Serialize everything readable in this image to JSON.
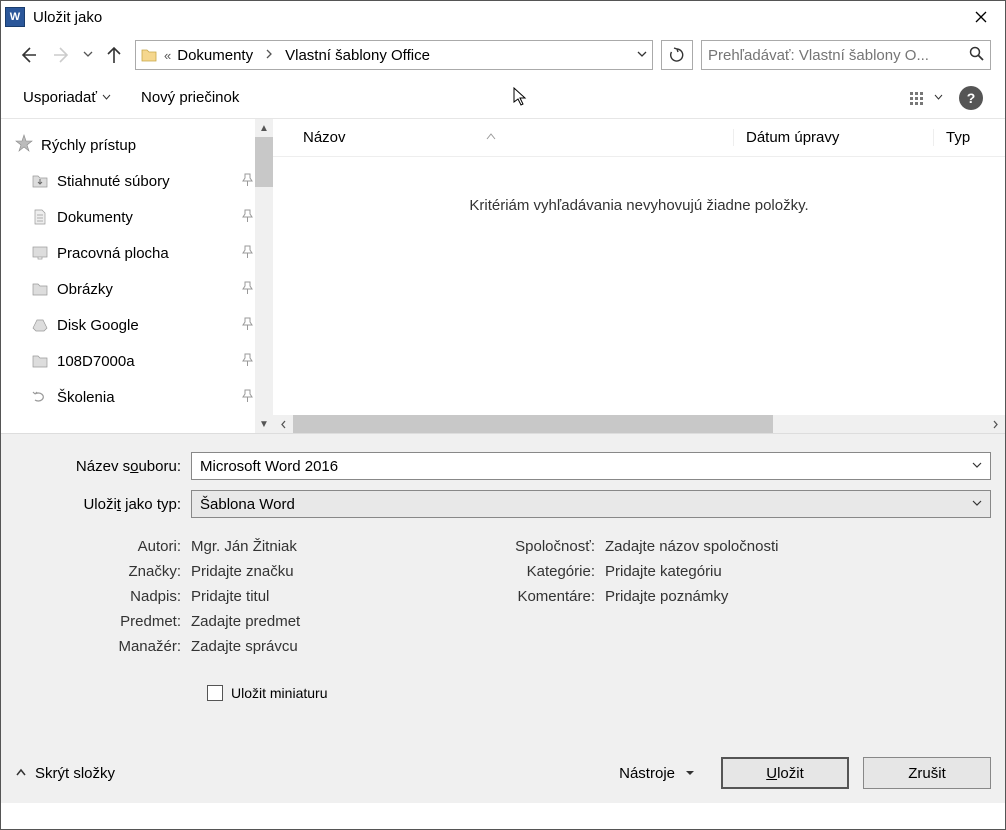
{
  "titlebar": {
    "title": "Uložit jako"
  },
  "nav": {
    "breadcrumb_prefix": "«",
    "breadcrumb": [
      "Dokumenty",
      "Vlastní šablony Office"
    ],
    "search_placeholder": "Prehľadávať: Vlastní šablony O..."
  },
  "toolbar": {
    "organize": "Usporiadať",
    "new_folder": "Nový priečinok"
  },
  "sidebar": {
    "quick_access": "Rýchly prístup",
    "items": [
      "Stiahnuté súbory",
      "Dokumenty",
      "Pracovná plocha",
      "Obrázky",
      "Disk Google",
      "108D7000a",
      "Školenia"
    ]
  },
  "columns": {
    "name": "Názov",
    "date": "Dátum úpravy",
    "type": "Typ"
  },
  "empty_message": "Kritériám vyhľadávania nevyhovujú žiadne položky.",
  "form": {
    "filename_label_pre": "Název s",
    "filename_label_ul": "o",
    "filename_label_post": "uboru:",
    "filename_value": "Microsoft Word 2016",
    "filetype_label_pre": "Uloži",
    "filetype_label_ul": "t",
    "filetype_label_post": " jako typ:",
    "filetype_value": "Šablona Word"
  },
  "meta": {
    "authors_label": "Autori:",
    "authors_value": "Mgr. Ján Žitniak",
    "tags_label": "Značky:",
    "tags_value": "Pridajte značku",
    "title_label": "Nadpis:",
    "title_value": "Pridajte titul",
    "subject_label": "Predmet:",
    "subject_value": "Zadajte predmet",
    "manager_label": "Manažér:",
    "manager_value": "Zadajte správcu",
    "company_label": "Spoločnosť:",
    "company_value": "Zadajte názov spoločnosti",
    "categories_label": "Kategórie:",
    "categories_value": "Pridajte kategóriu",
    "comments_label": "Komentáre:",
    "comments_value": "Pridajte poznámky"
  },
  "checkbox_label": "Uložit miniaturu",
  "buttons": {
    "hide_folders": "Skrýt složky",
    "tools_ul": "N",
    "tools_post": "ástroje",
    "save_ul": "U",
    "save_post": "ložit",
    "cancel": "Zrušit"
  }
}
